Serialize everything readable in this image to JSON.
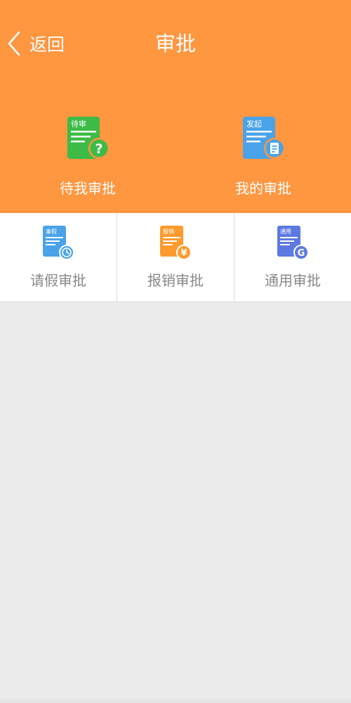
{
  "header": {
    "back_label": "返回",
    "title": "审批"
  },
  "big_tiles": [
    {
      "icon": "pending-approval-icon",
      "tag": "待审",
      "label": "待我审批",
      "color": "#3dbb46",
      "badge": "?"
    },
    {
      "icon": "my-approval-icon",
      "tag": "发起",
      "label": "我的审批",
      "color": "#4aa3e8",
      "badge": "doc"
    }
  ],
  "grid": [
    {
      "icon": "leave-icon",
      "tag": "事假",
      "label": "请假审批",
      "color": "#4aa3e8",
      "badge": "clock"
    },
    {
      "icon": "reimburse-icon",
      "tag": "报销",
      "label": "报销审批",
      "color": "#ff9a2e",
      "badge": "¥"
    },
    {
      "icon": "general-icon",
      "tag": "通用",
      "label": "通用审批",
      "color": "#5b79e0",
      "badge": "G"
    }
  ],
  "colors": {
    "header_bg": "#ff9640",
    "page_bg": "#ebebeb"
  }
}
